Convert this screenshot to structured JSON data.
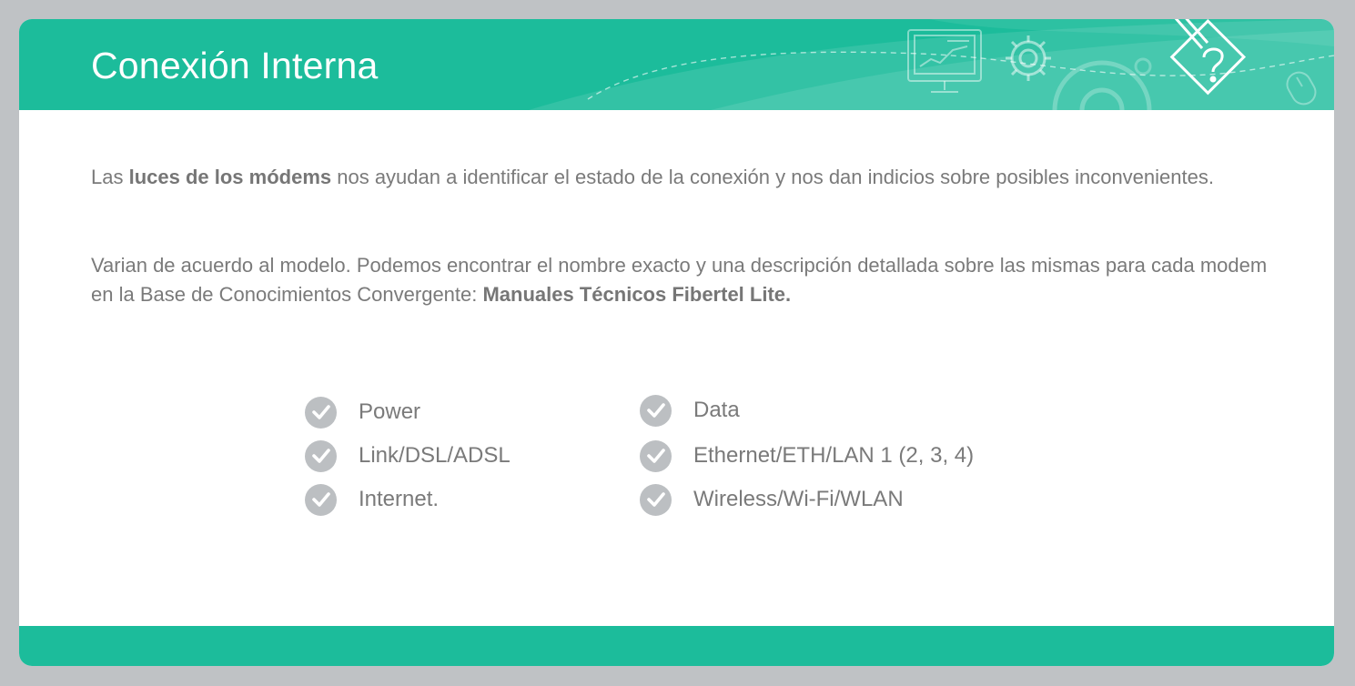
{
  "slide": {
    "title": "Conexión Interna",
    "paragraph1": {
      "prefix": "Las ",
      "bold": "luces de los módems",
      "suffix": " nos ayudan a identificar el estado de la conexión y nos dan indicios sobre posibles inconvenientes."
    },
    "paragraph2": {
      "prefix": "Varian de acuerdo al modelo. Podemos encontrar el nombre exacto y una descripción detallada sobre las mismas para cada modem en la Base de Conocimientos Convergente: ",
      "bold": "Manuales Técnicos Fibertel Lite."
    },
    "lights_left": [
      "Power",
      "Link/DSL/ADSL",
      "Internet."
    ],
    "lights_right": [
      "Data",
      "Ethernet/ETH/LAN 1 (2, 3, 4)",
      "Wireless/Wi-Fi/WLAN"
    ]
  },
  "colors": {
    "accent": "#1cbc9b",
    "text": "#7a7a7a",
    "check_bg": "#bcbfc2",
    "frame": "#bfc2c5"
  },
  "icons": {
    "header": [
      "monitor-chart-icon",
      "gear-icon",
      "large-gear-icon",
      "pencil-question-icon",
      "mouse-icon"
    ],
    "list_bullet": "checkmark-circle-icon"
  }
}
